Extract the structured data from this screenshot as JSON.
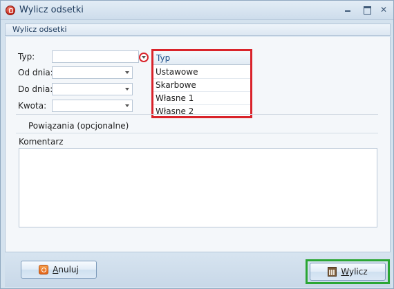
{
  "window": {
    "title": "Wylicz odsetki"
  },
  "tab": {
    "label": "Wylicz odsetki"
  },
  "form": {
    "typ_label": "Typ:",
    "typ_value": "",
    "od_label": "Od dnia:",
    "od_value": "",
    "do_label": "Do dnia:",
    "do_value": "",
    "kwota_label": "Kwota:",
    "kwota_value": "",
    "powiazania_label": "Powiązania (opcjonalne)",
    "komentarz_label": "Komentarz",
    "komentarz_value": ""
  },
  "dropdown": {
    "header": "Typ",
    "items": [
      "Ustawowe",
      "Skarbowe",
      "Własne 1",
      "Własne 2"
    ]
  },
  "footer": {
    "cancel_prefix": "",
    "cancel_underlined": "A",
    "cancel_rest": "nuluj",
    "calc_underlined": "W",
    "calc_rest": "ylicz"
  },
  "colors": {
    "highlight_red": "#d9232a",
    "highlight_green": "#2aa634"
  },
  "icons": {
    "app": "app-icon",
    "minimize": "minimize-icon",
    "maximize": "maximize-icon",
    "close": "close-icon",
    "cancel": "cancel-icon",
    "calculator": "calculator-icon",
    "dropdown": "chevron-down-icon"
  }
}
